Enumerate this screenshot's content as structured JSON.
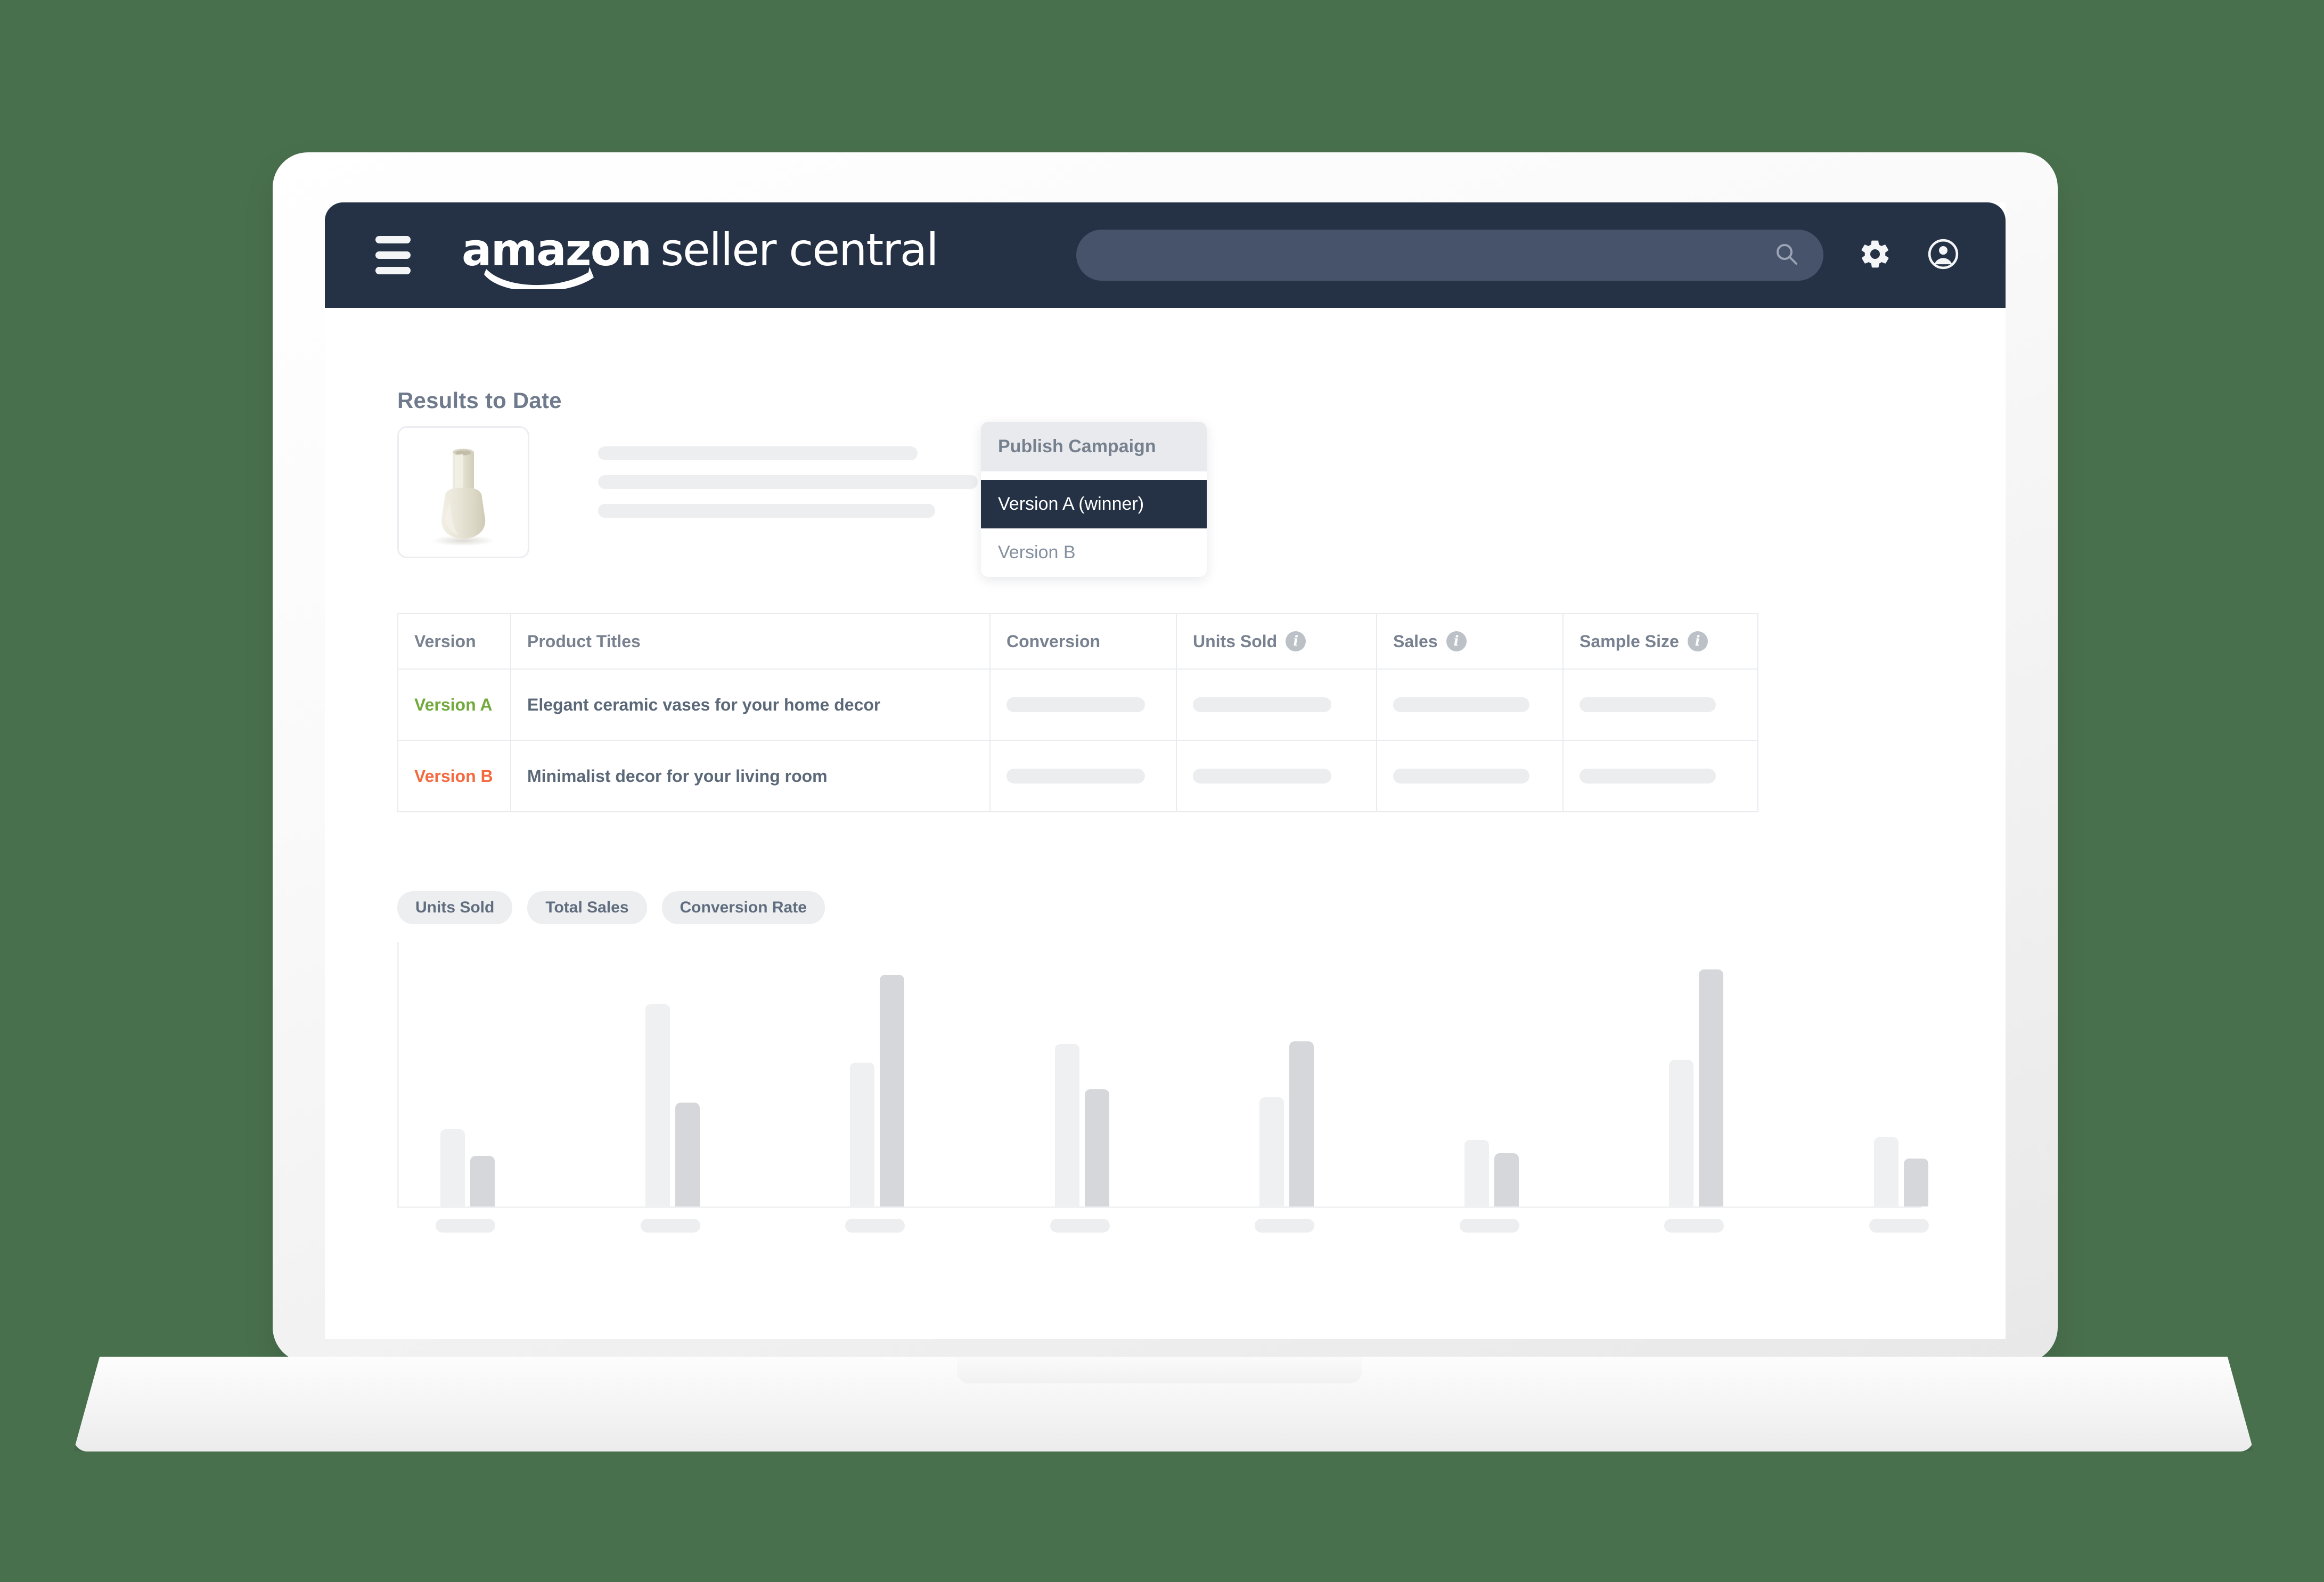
{
  "background_color": "#49704d",
  "navbar": {
    "background_color": "#253145",
    "menu_icon": "hamburger-menu-icon",
    "brand": {
      "word_1": "amazon",
      "word_2": "seller central"
    },
    "search": {
      "value": "",
      "placeholder": "",
      "icon": "search-icon"
    },
    "settings_icon": "gear-icon",
    "account_icon": "user-account-icon"
  },
  "page": {
    "title": "Results to Date"
  },
  "product": {
    "thumbnail_alt": "ceramic-vase-product-image",
    "skeleton_lines": 3
  },
  "publish_dropdown": {
    "header": "Publish Campaign",
    "options": [
      {
        "label": "Version A  (winner)",
        "selected": true
      },
      {
        "label": "Version B",
        "selected": false
      }
    ]
  },
  "results_table": {
    "columns": [
      {
        "label": "Version",
        "info": false
      },
      {
        "label": "Product Titles",
        "info": false
      },
      {
        "label": "Conversion",
        "info": false
      },
      {
        "label": "Units Sold",
        "info": true
      },
      {
        "label": "Sales",
        "info": true
      },
      {
        "label": "Sample Size",
        "info": true
      }
    ],
    "info_icon_glyph": "i",
    "rows": [
      {
        "version": "Version A",
        "version_color": "#72a93c",
        "title": "Elegant ceramic vases for your home decor",
        "conversion": "",
        "units_sold": "",
        "sales": "",
        "sample_size": ""
      },
      {
        "version": "Version B",
        "version_color": "#f4693f",
        "title": "Minimalist decor for your living room",
        "conversion": "",
        "units_sold": "",
        "sales": "",
        "sample_size": ""
      }
    ]
  },
  "metric_chips": [
    {
      "label": "Units Sold"
    },
    {
      "label": "Total Sales"
    },
    {
      "label": "Conversion Rate"
    }
  ],
  "chart_data": {
    "type": "bar",
    "title": "",
    "xlabel": "",
    "ylabel": "",
    "grid": false,
    "legend_position": "none",
    "axis_tick_labels_hidden": true,
    "categories": [
      "",
      "",
      "",
      "",
      "",
      "",
      "",
      ""
    ],
    "ylim": [
      0,
      100
    ],
    "colors": {
      "series_a": "#eef0f1",
      "series_b": "#d5d7da"
    },
    "series": [
      {
        "name": "Version A",
        "values": [
          29,
          76,
          54,
          61,
          41,
          25,
          55,
          26
        ]
      },
      {
        "name": "Version B",
        "values": [
          19,
          39,
          87,
          44,
          62,
          20,
          89,
          18
        ]
      }
    ]
  }
}
